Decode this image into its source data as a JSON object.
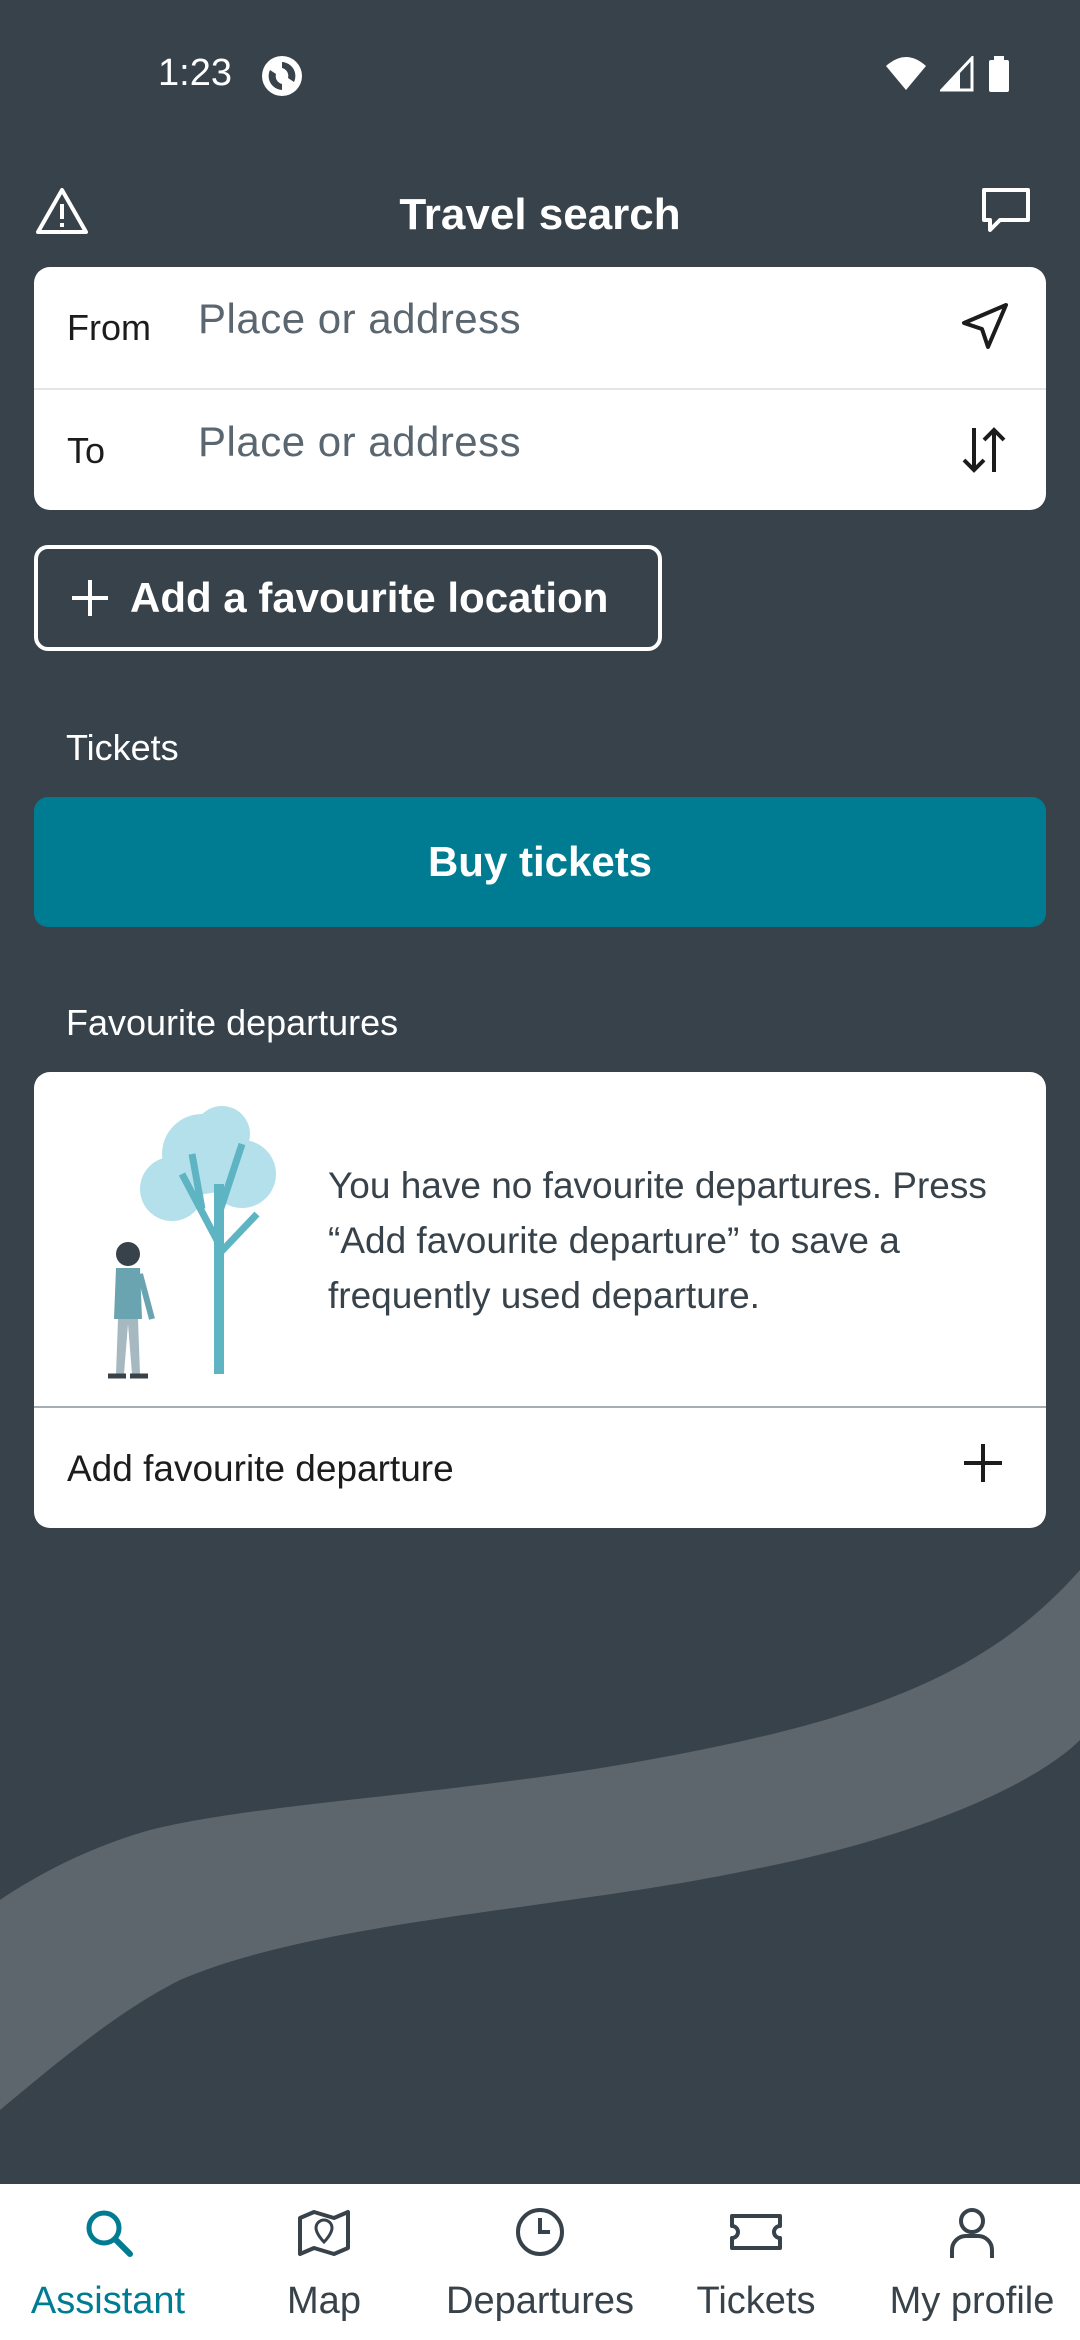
{
  "status_bar": {
    "time": "1:23",
    "icons": [
      "app-sync-icon",
      "wifi-icon",
      "signal-icon",
      "battery-icon"
    ]
  },
  "header": {
    "title": "Travel search",
    "left_icon": "alert-triangle-icon",
    "right_icon": "chat-bubble-icon"
  },
  "search": {
    "from_label": "From",
    "from_placeholder": "Place or address",
    "from_action_icon": "location-arrow-icon",
    "to_label": "To",
    "to_placeholder": "Place or address",
    "to_action_icon": "swap-vertical-icon"
  },
  "favourite_location": {
    "label": "Add a favourite location"
  },
  "tickets": {
    "section_label": "Tickets",
    "buy_label": "Buy tickets"
  },
  "favourite_departures": {
    "section_label": "Favourite departures",
    "empty_text": "You have no favourite departures. Press “Add favourite departure” to save a frequently used departure.",
    "add_label": "Add favourite departure"
  },
  "tabs": [
    {
      "label": "Assistant",
      "icon": "search-icon",
      "active": true
    },
    {
      "label": "Map",
      "icon": "map-icon",
      "active": false
    },
    {
      "label": "Departures",
      "icon": "clock-icon",
      "active": false
    },
    {
      "label": "Tickets",
      "icon": "ticket-icon",
      "active": false
    },
    {
      "label": "My profile",
      "icon": "profile-icon",
      "active": false
    }
  ],
  "colors": {
    "background": "#37424a",
    "accent": "#007c92",
    "card": "#ffffff",
    "swoosh": "#5d666d"
  }
}
